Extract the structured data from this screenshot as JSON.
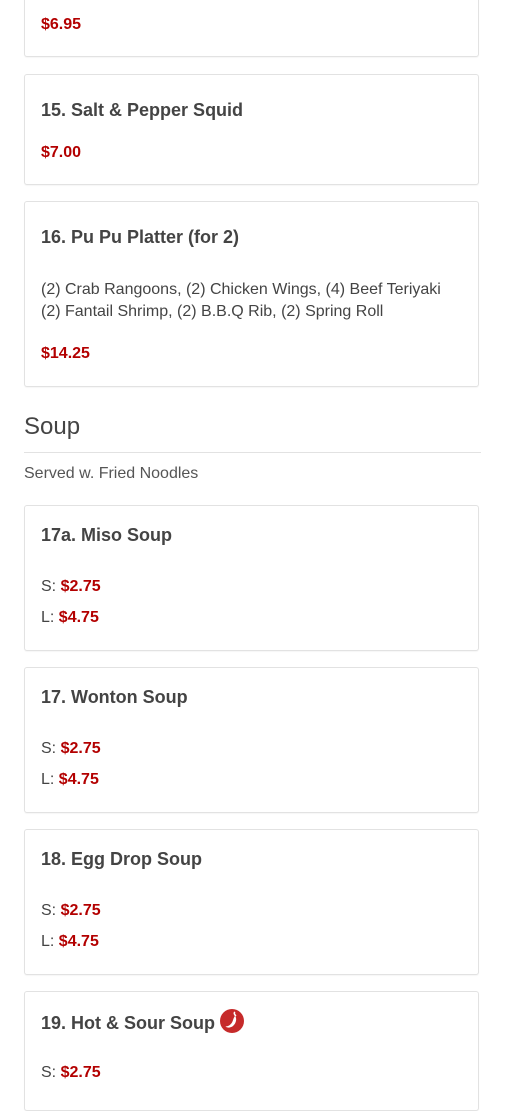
{
  "items": [
    {
      "price": "$6.95"
    },
    {
      "title": "15. Salt & Pepper Squid",
      "price": "$7.00"
    },
    {
      "title": "16. Pu Pu Platter (for 2)",
      "description": "(2) Crab Rangoons, (2) Chicken Wings, (4) Beef Teriyaki (2) Fantail Shrimp, (2) B.B.Q Rib, (2) Spring Roll",
      "price": "$14.25"
    }
  ],
  "section": {
    "title": "Soup",
    "subtitle": "Served w. Fried Noodles"
  },
  "soups": [
    {
      "title": "17a. Miso Soup",
      "small_label": "S:",
      "small_price": "$2.75",
      "large_label": "L:",
      "large_price": "$4.75"
    },
    {
      "title": "17. Wonton Soup",
      "small_label": "S:",
      "small_price": "$2.75",
      "large_label": "L:",
      "large_price": "$4.75"
    },
    {
      "title": "18. Egg Drop Soup",
      "small_label": "S:",
      "small_price": "$2.75",
      "large_label": "L:",
      "large_price": "$4.75"
    },
    {
      "title": "19. Hot & Sour Soup",
      "icon": "spicy-pepper-icon",
      "small_label": "S:",
      "small_price": "$2.75"
    }
  ],
  "colors": {
    "price": "#b30000",
    "spicy_icon": "#c62a2a",
    "border": "#e2e2e2"
  }
}
